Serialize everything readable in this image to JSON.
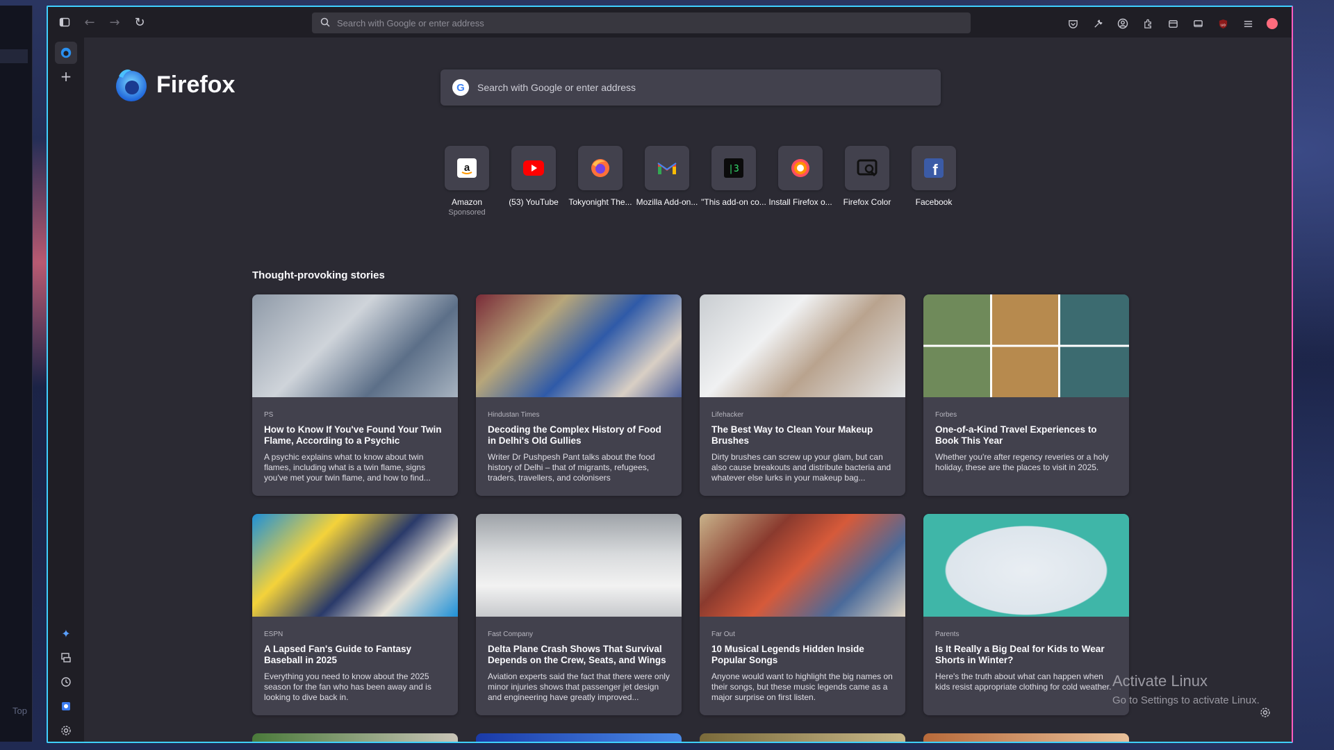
{
  "desktop": {
    "left_panel_label": "Top"
  },
  "browser": {
    "urlbar_placeholder": "Search with Google or enter address"
  },
  "newtab": {
    "logo_text": "Firefox",
    "search_placeholder": "Search with Google or enter address",
    "shortcuts": [
      {
        "label": "Amazon",
        "sub": "Sponsored",
        "icon": "amazon-icon"
      },
      {
        "label": "(53) YouTube",
        "sub": "",
        "icon": "youtube-icon"
      },
      {
        "label": "Tokyonight The...",
        "sub": "",
        "icon": "firefox-icon"
      },
      {
        "label": "Mozilla Add-on...",
        "sub": "",
        "icon": "gmail-icon"
      },
      {
        "label": "\"This add-on co...",
        "sub": "",
        "icon": "terminal-icon"
      },
      {
        "label": "Install Firefox o...",
        "sub": "",
        "icon": "firefox-color-icon"
      },
      {
        "label": "Firefox Color",
        "sub": "",
        "icon": "firefox-color-tool-icon"
      },
      {
        "label": "Facebook",
        "sub": "",
        "icon": "facebook-icon"
      }
    ],
    "section_title": "Thought-provoking stories",
    "stories": [
      {
        "source": "PS",
        "title": "How to Know If You've Found Your Twin Flame, According to a Psychic",
        "desc": "A psychic explains what to know about twin flames, including what is a twin flame, signs you've met your twin flame, and how to find..."
      },
      {
        "source": "Hindustan Times",
        "title": "Decoding the Complex History of Food in Delhi's Old Gullies",
        "desc": "Writer Dr Pushpesh Pant talks about the food history of Delhi – that of migrants, refugees, traders, travellers, and colonisers"
      },
      {
        "source": "Lifehacker",
        "title": "The Best Way to Clean Your Makeup Brushes",
        "desc": "Dirty brushes can screw up your glam, but can also cause breakouts and distribute bacteria and whatever else lurks in your makeup bag..."
      },
      {
        "source": "Forbes",
        "title": "One-of-a-Kind Travel Experiences to Book This Year",
        "desc": "Whether you're after regency reveries or a holy holiday, these are the places to visit in 2025."
      },
      {
        "source": "ESPN",
        "title": "A Lapsed Fan's Guide to Fantasy Baseball in 2025",
        "desc": "Everything you need to know about the 2025 season for the fan who has been away and is looking to dive back in."
      },
      {
        "source": "Fast Company",
        "title": "Delta Plane Crash Shows That Survival Depends on the Crew, Seats, and Wings",
        "desc": "Aviation experts said the fact that there were only minor injuries shows that passenger jet design and engineering have greatly improved..."
      },
      {
        "source": "Far Out",
        "title": "10 Musical Legends Hidden Inside Popular Songs",
        "desc": "Anyone would want to highlight the big names on their songs, but these music legends came as a major surprise on first listen."
      },
      {
        "source": "Parents",
        "title": "Is It Really a Big Deal for Kids to Wear Shorts in Winter?",
        "desc": "Here's the truth about what can happen when kids resist appropriate clothing for cold weather."
      }
    ]
  },
  "watermark": {
    "line1": "Activate Linux",
    "line2": "Go to Settings to activate Linux."
  },
  "colors": {
    "accent_left": "#3fd0ff",
    "accent_right": "#ff5cc0",
    "card_bg": "#42414d",
    "page_bg": "#2b2a33"
  }
}
